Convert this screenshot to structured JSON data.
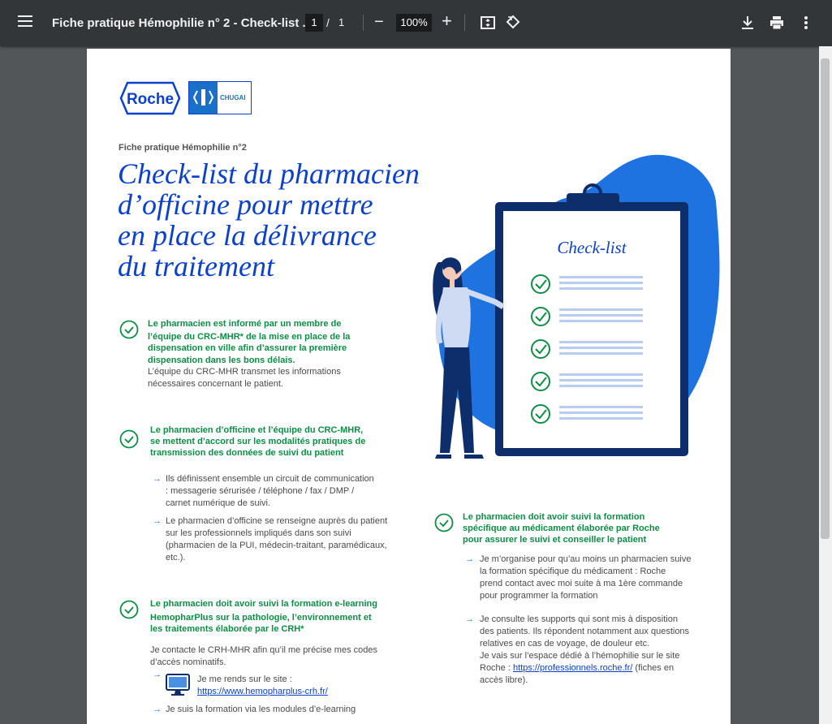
{
  "toolbar": {
    "title": "Fiche pratique Hémophilie n° 2 - Check-list ...",
    "page_current": "1",
    "page_separator": "/",
    "page_total": "1",
    "zoom": "100%",
    "icons": [
      "menu-icon",
      "zoom-out-icon",
      "zoom-in-icon",
      "fit-page-icon",
      "rotate-icon",
      "download-icon",
      "print-icon",
      "more-icon"
    ]
  },
  "doc": {
    "logo_roche": "Roche",
    "logo_chugai": "CHUGAI",
    "subtitle": "Fiche pratique Hémophilie n°2",
    "title_lines": [
      "Check-list du pharmacien",
      "d’officine pour mettre",
      "en place la délivrance",
      "du traitement"
    ],
    "illustration_label": "Check-list",
    "s1": {
      "lines": [
        "Le pharmacien est informé par un membre de",
        "l’équipe du CRC-MHR* de la mise en place de la",
        "dispensation en ville afin d’assurer la première",
        "dispensation dans les bons délais."
      ],
      "body": [
        "L’équipe du CRC-MHR transmet les informations",
        "nécessaires concernant le patient."
      ]
    },
    "s2": {
      "lines": [
        "Le pharmacien d’officine et l’équipe du CRC-MHR,",
        "se mettent d’accord sur les modalités pratiques de",
        "transmission des données de suivi du patient"
      ],
      "b1": [
        "Ils définissent ensemble un circuit de communication",
        ": messagerie sérurisée / téléphone / fax / DMP /",
        "carnet numérique de suivi."
      ],
      "b2": [
        "Le pharmacien d’officine se renseigne auprès du patient",
        "sur les professionnels impliqués dans son suivi",
        "(pharmacien de la PUI, médecin-traitant, paramédicaux,",
        "etc.)."
      ]
    },
    "s3": {
      "lines": [
        "Le pharmacien doit avoir suivi la formation e-learning",
        "HemopharPlus sur la pathologie, l’environnement et",
        "les traitements élaborée par le CRH*"
      ],
      "body": [
        "Je contacte le CRH-MHR afin qu’il me précise mes codes",
        "d’accès nominatifs."
      ],
      "site_label": "Je me rends sur le site :",
      "site_url": "https://www.hemopharplus-crh.fr/",
      "b2": "Je suis la formation via les modules d’e-learning"
    },
    "s4": {
      "lines": [
        "Le pharmacien doit avoir suivi la formation",
        "spécifique au médicament élaborée par Roche",
        "pour assurer le suivi et conseiller le patient"
      ],
      "b1": [
        "Je m’organise pour qu’au moins un pharmacien suive",
        "la formation spécifique du médicament : Roche",
        "prend contact avec moi suite à ma 1ère commande",
        "pour programmer la formation"
      ],
      "b2": [
        "Je consulte les supports qui sont mis à disposition",
        "des patients. Ils répondent notamment aux questions",
        "relatives en cas de voyage, de douleur etc.",
        "Je vais sur l’espace dédié à l’hémophilie sur le site"
      ],
      "b2_prefix": "Roche :",
      "b2_link": "https://professionnels.roche.fr/",
      "b2_suffix": "(fiches en",
      "b2_last": "accès libre)."
    }
  }
}
